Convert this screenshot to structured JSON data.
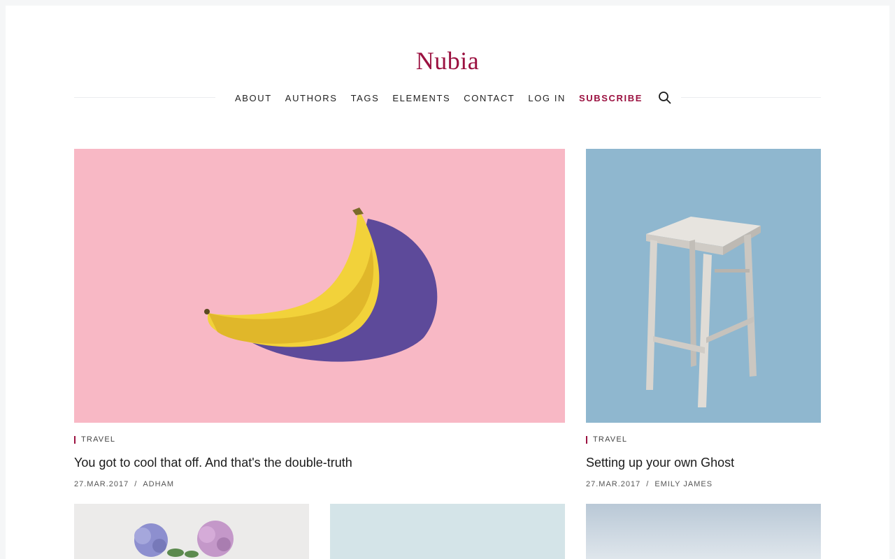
{
  "site": {
    "logo": "Nubia",
    "accent": "#9b1140"
  },
  "nav": {
    "items": [
      "ABOUT",
      "AUTHORS",
      "TAGS",
      "ELEMENTS",
      "CONTACT",
      "LOG IN"
    ],
    "subscribe": "SUBSCRIBE",
    "search_icon": "search-icon"
  },
  "posts": [
    {
      "tag": "TRAVEL",
      "title": "You got to cool that off. And that's the double-truth",
      "date": "27.MAR.2017",
      "sep": "/",
      "author": "ADHAM",
      "image": "banana-on-pink"
    },
    {
      "tag": "TRAVEL",
      "title": "Setting up your own Ghost",
      "date": "27.MAR.2017",
      "sep": "/",
      "author": "EMILY JAMES",
      "image": "wooden-stool-on-blue"
    }
  ],
  "more_posts_images": [
    "hydrangea-flowers",
    "pale-blue",
    "sky"
  ]
}
